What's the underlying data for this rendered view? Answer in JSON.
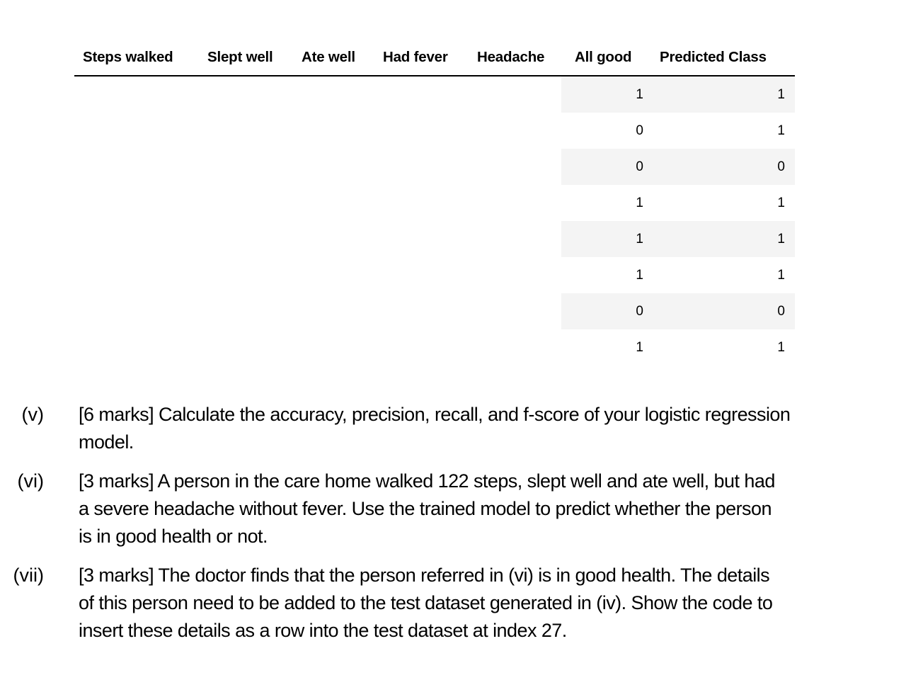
{
  "table": {
    "columns": [
      "Steps walked",
      "Slept well",
      "Ate well",
      "Had fever",
      "Headache",
      "All good",
      "Predicted Class"
    ],
    "rows": [
      {
        "all_good": "1",
        "predicted": "1"
      },
      {
        "all_good": "0",
        "predicted": "1"
      },
      {
        "all_good": "0",
        "predicted": "0"
      },
      {
        "all_good": "1",
        "predicted": "1"
      },
      {
        "all_good": "1",
        "predicted": "1"
      },
      {
        "all_good": "1",
        "predicted": "1"
      },
      {
        "all_good": "0",
        "predicted": "0"
      },
      {
        "all_good": "1",
        "predicted": "1"
      }
    ]
  },
  "questions": [
    {
      "number": "(v)",
      "lines": [
        "[6 marks] Calculate the accuracy, precision, recall, and f-score of your logistic regression",
        "model."
      ]
    },
    {
      "number": "(vi)",
      "lines": [
        "[3 marks] A person in the care home walked 122 steps, slept well and ate well, but had",
        "a severe headache without fever. Use the trained model to predict whether the person",
        "is in good health or not."
      ]
    },
    {
      "number": "(vii)",
      "lines": [
        "[3 marks] The doctor finds that the person referred in (vi) is in good health. The details",
        "of this person need to be added to the test dataset generated in (iv). Show the code to",
        "insert these details as a row into the test dataset at index 27."
      ]
    }
  ]
}
